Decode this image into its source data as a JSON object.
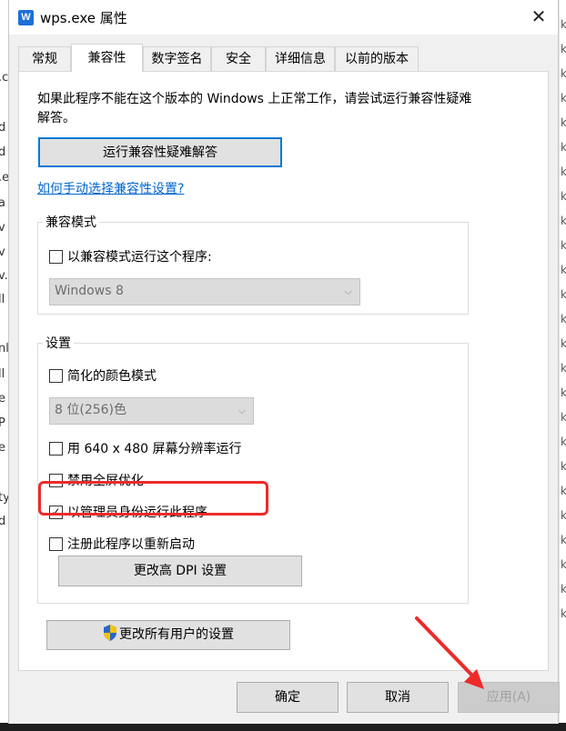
{
  "window": {
    "title": "wps.exe 属性",
    "app_icon_letter": "W",
    "close_glyph": "✕"
  },
  "background_window": {
    "left_fragments": [
      ".c",
      "d",
      "d",
      ".e",
      "a",
      "v",
      "v",
      "v.",
      "ll",
      "nl",
      "ll",
      "e",
      "P",
      "e",
      "ty",
      "d"
    ],
    "right_fragments": [
      "k",
      "k",
      "k",
      "k",
      "k",
      "k",
      "k",
      "k",
      "k",
      "k",
      "k",
      "k",
      "k",
      "k",
      "k",
      "k",
      "k",
      "k",
      "k",
      "k",
      "k",
      "k",
      "k",
      "k",
      "k"
    ]
  },
  "tabs": [
    {
      "label": "常规",
      "active": false
    },
    {
      "label": "兼容性",
      "active": true
    },
    {
      "label": "数字签名",
      "active": false
    },
    {
      "label": "安全",
      "active": false
    },
    {
      "label": "详细信息",
      "active": false
    },
    {
      "label": "以前的版本",
      "active": false
    }
  ],
  "compat": {
    "intro_text": "如果此程序不能在这个版本的 Windows 上正常工作，请尝试运行兼容性疑难解答。",
    "troubleshoot_button": "运行兼容性疑难解答",
    "manual_link": "如何手动选择兼容性设置?",
    "mode_group": {
      "legend": "兼容模式",
      "checkbox_label": "以兼容模式运行这个程序:",
      "checked": false,
      "os_select_value": "Windows 8"
    },
    "settings_group": {
      "legend": "设置",
      "reduced_color_label": "简化的颜色模式",
      "reduced_color_checked": false,
      "color_select_value": "8 位(256)色",
      "res_640_label": "用 640 x 480 屏幕分辨率运行",
      "res_640_checked": false,
      "disable_fullscreen_label": "禁用全屏优化",
      "disable_fullscreen_checked": false,
      "run_as_admin_label": "以管理员身份运行此程序",
      "run_as_admin_checked": true,
      "register_restart_label": "注册此程序以重新启动",
      "register_restart_checked": false,
      "dpi_button": "更改高 DPI 设置"
    },
    "change_all_users_button": "更改所有用户的设置"
  },
  "footer": {
    "ok": "确定",
    "cancel": "取消",
    "apply": "应用(A)"
  },
  "colors": {
    "highlight": "#ee2a2a",
    "link": "#0066cc",
    "focus": "#0078d7"
  },
  "check_glyph": "✓",
  "chevron_glyph": "⌵"
}
